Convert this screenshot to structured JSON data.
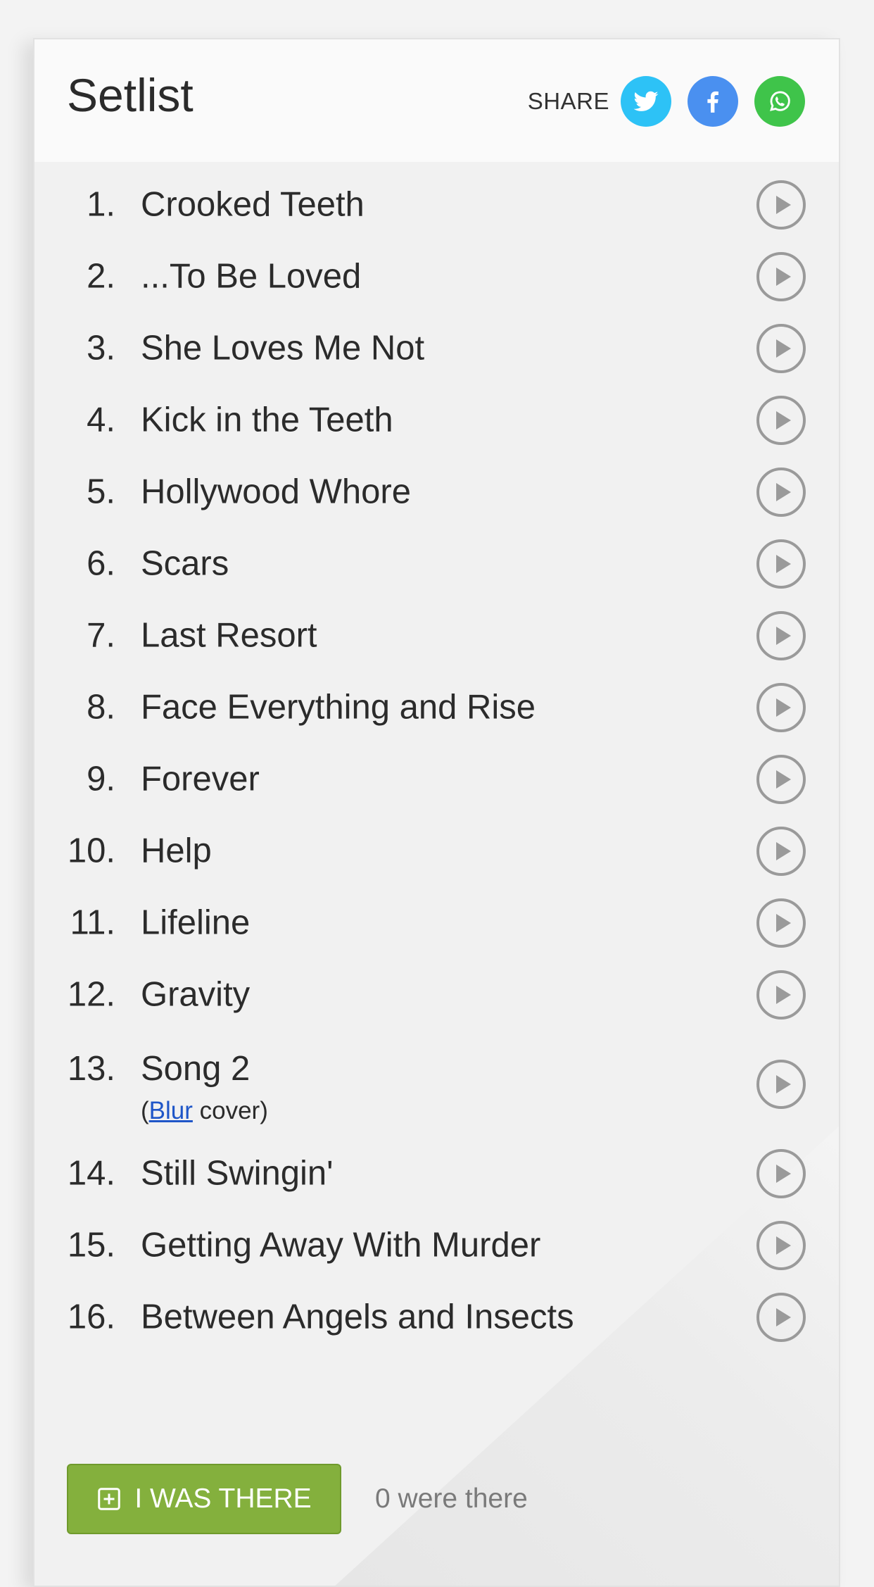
{
  "setlist": {
    "title": "Setlist",
    "share": {
      "label": "SHARE",
      "buttons": [
        {
          "name": "twitter",
          "icon": "twitter-icon",
          "color": "#2dc2f6"
        },
        {
          "name": "facebook",
          "icon": "facebook-icon",
          "color": "#4a90f0"
        },
        {
          "name": "whatsapp",
          "icon": "whatsapp-icon",
          "color": "#3fc44a"
        }
      ]
    },
    "songs": [
      {
        "number": "1.",
        "title": "Crooked Teeth"
      },
      {
        "number": "2.",
        "title": "...To Be Loved"
      },
      {
        "number": "3.",
        "title": "She Loves Me Not"
      },
      {
        "number": "4.",
        "title": "Kick in the Teeth"
      },
      {
        "number": "5.",
        "title": "Hollywood Whore"
      },
      {
        "number": "6.",
        "title": "Scars"
      },
      {
        "number": "7.",
        "title": "Last Resort"
      },
      {
        "number": "8.",
        "title": "Face Everything and Rise"
      },
      {
        "number": "9.",
        "title": "Forever"
      },
      {
        "number": "10.",
        "title": "Help"
      },
      {
        "number": "11.",
        "title": "Lifeline"
      },
      {
        "number": "12.",
        "title": "Gravity"
      },
      {
        "number": "13.",
        "title": "Song 2",
        "note": {
          "prefix": "(",
          "link": "Blur",
          "suffix": " cover)"
        }
      },
      {
        "number": "14.",
        "title": "Still Swingin'"
      },
      {
        "number": "15.",
        "title": "Getting Away With Murder"
      },
      {
        "number": "16.",
        "title": "Between Angels and Insects"
      }
    ],
    "play_icon": "play-circle-icon",
    "footer": {
      "button_label": "I WAS THERE",
      "button_icon": "plus-square-icon",
      "button_color": "#84b03d",
      "attendance_text": "0 were there"
    }
  }
}
